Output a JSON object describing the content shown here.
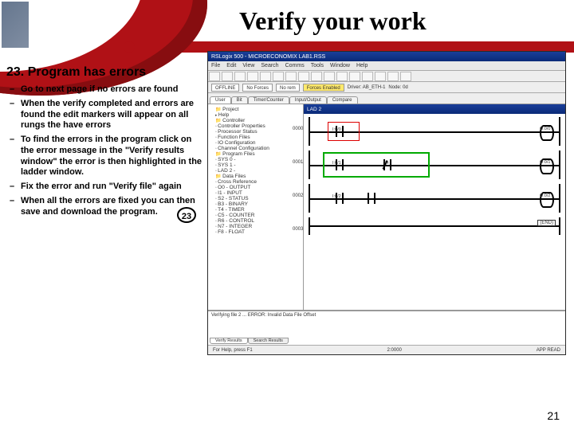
{
  "slide": {
    "title": "Verify your work",
    "heading": "23. Program has errors",
    "bullets": [
      "Go to next page if no errors are found",
      "When the verify completed and errors are found the edit markers will appear on all rungs the have errors",
      "To find the errors in the program click on the error message in the \"Verify results window\" the error is then highlighted in the ladder window.",
      "Fix the error and run \"Verify file\" again",
      "When all the errors are fixed you can then save and download the program."
    ],
    "step_badge": "23",
    "page_number": "21"
  },
  "app": {
    "window_title": "RSLogix 500 - MICROECONOMIX LAB1.RSS",
    "menu": [
      "File",
      "Edit",
      "View",
      "Search",
      "Comms",
      "Tools",
      "Window",
      "Help"
    ],
    "status_row": {
      "left1": "OFFLINE",
      "left2": "No Forces",
      "mid1": "No rem",
      "mid2": "Forces Enabled",
      "driver": "Driver: AB_ETH-1",
      "node": "Node: 0d"
    },
    "main_tabs": [
      "User",
      "Bit",
      "Timer/Counter",
      "Input/Output",
      "Compare"
    ],
    "tree": {
      "root": "Project",
      "items": [
        "Help",
        "Controller",
        "Controller Properties",
        "Processor Status",
        "Function Files",
        "IO Configuration",
        "Channel Configuration",
        "Program Files",
        "SYS 0 -",
        "SYS 1 -",
        "LAD 2 -",
        "Data Files",
        "Cross Reference",
        "O0 - OUTPUT",
        "I1 - INPUT",
        "S2 - STATUS",
        "B3 - BINARY",
        "T4 - TIMER",
        "C5 - COUNTER",
        "R6 - CONTROL",
        "N7 - INTEGER",
        "F8 - FLOAT"
      ]
    },
    "ladder": {
      "title": "LAD 2",
      "rungs": [
        {
          "num": "0000",
          "c1_addr": "I:0/0",
          "coil_addr": "O:0/0"
        },
        {
          "num": "0001",
          "c1_addr": "I:0/1",
          "c2_addr": "T4",
          "coil_addr": "O:0/1"
        },
        {
          "num": "0002",
          "c1_addr": "I:0/2",
          "coil_addr": "O:0/2"
        },
        {
          "num": "0003",
          "end": "(END)"
        }
      ]
    },
    "verify": {
      "line": "Verifying file 2 ... ERROR: Invalid Data File Offset",
      "tabs": [
        "Verify Results",
        "Search Results"
      ]
    },
    "statusbar": {
      "left": "For Help, press F1",
      "mid": "2:0000",
      "right": "APP  READ"
    }
  }
}
